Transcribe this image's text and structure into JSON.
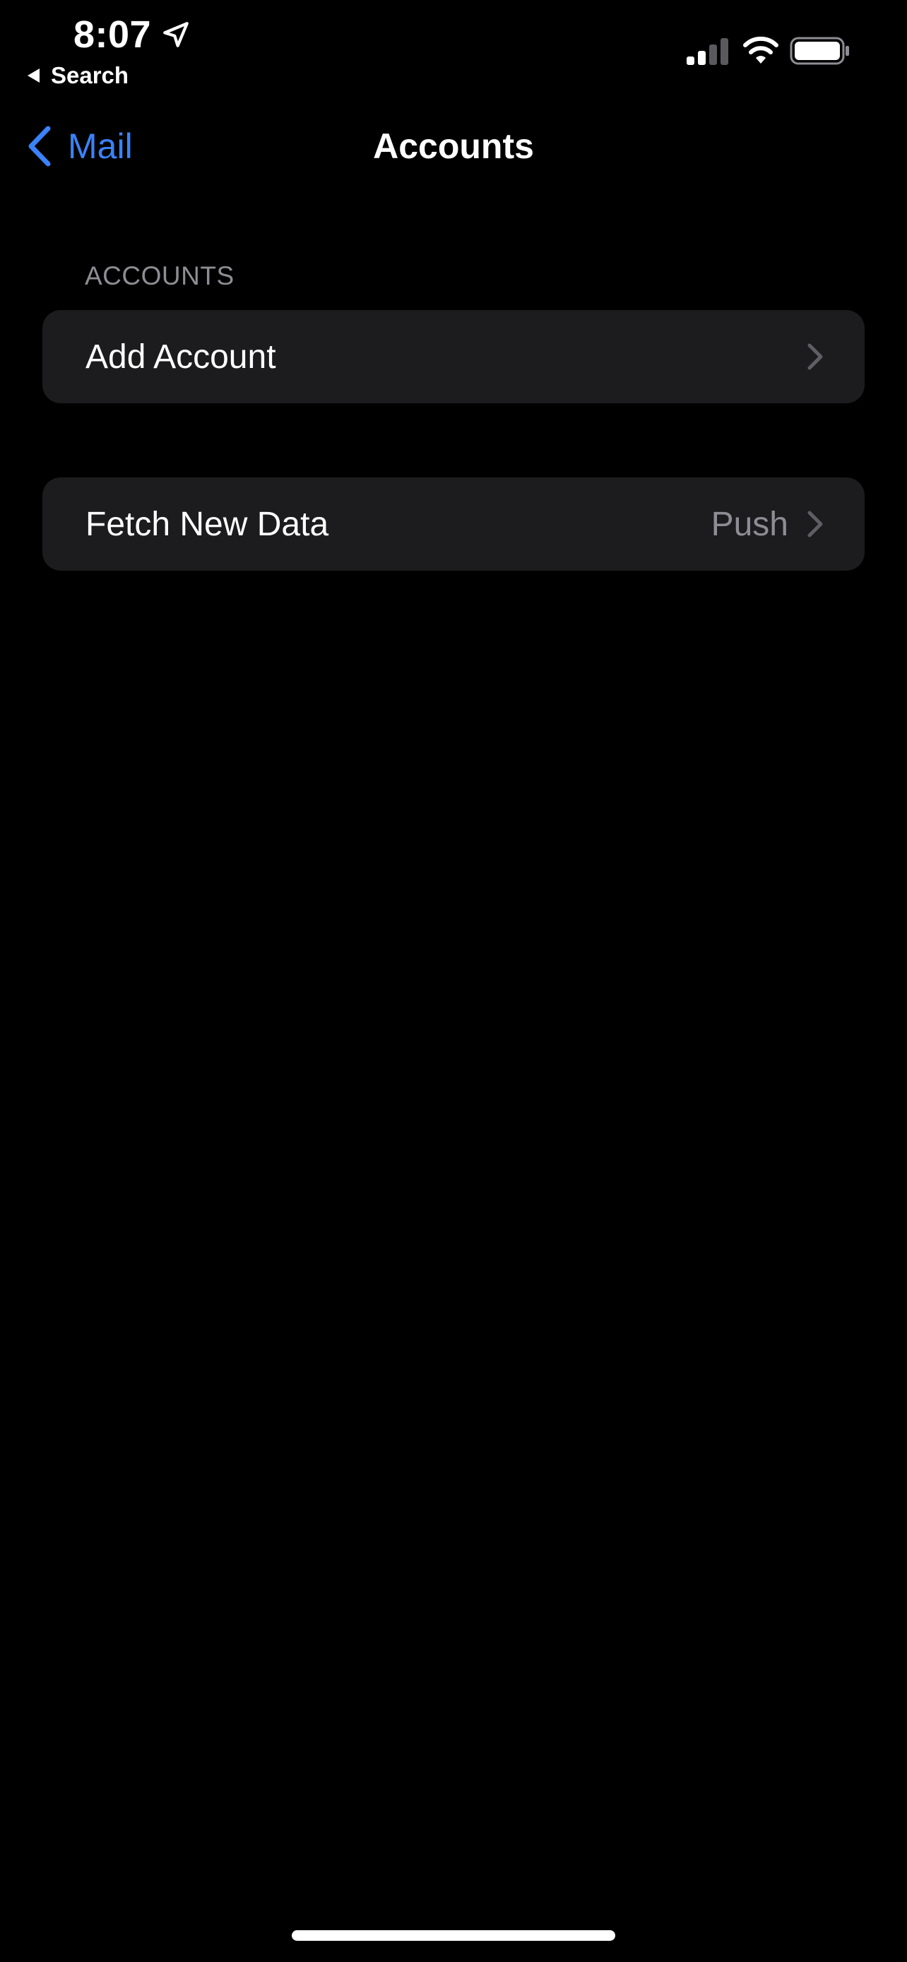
{
  "status_bar": {
    "time": "8:07",
    "back_app": "Search"
  },
  "nav": {
    "back_label": "Mail",
    "title": "Accounts",
    "accent_color": "#3a82f7"
  },
  "accounts_section": {
    "header": "ACCOUNTS",
    "add_account_label": "Add Account"
  },
  "fetch_section": {
    "label": "Fetch New Data",
    "value": "Push"
  },
  "icons": {
    "location": "location-arrow-icon",
    "back_triangle": "back-triangle-icon",
    "signal": "cellular-signal-icon",
    "wifi": "wifi-icon",
    "battery": "battery-icon",
    "nav_back": "chevron-left-icon",
    "disclosure": "chevron-right-icon"
  },
  "colors": {
    "background": "#000000",
    "cell_background": "#1c1c1e",
    "secondary_text": "#8d8d93"
  }
}
